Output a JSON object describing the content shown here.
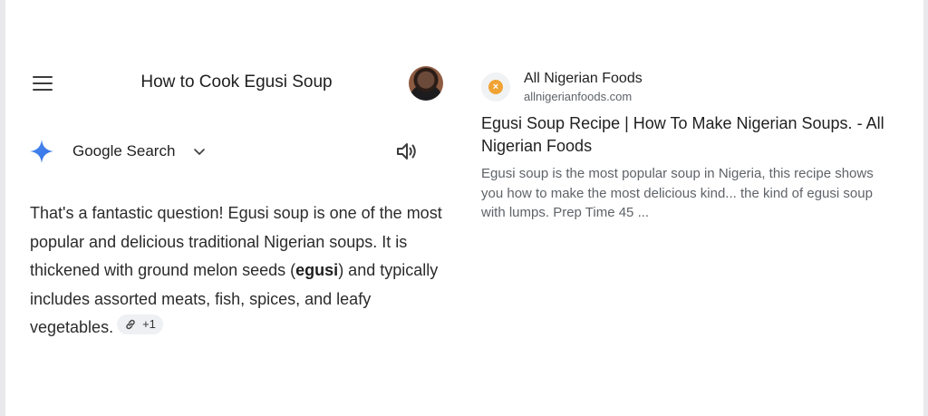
{
  "header": {
    "title": "How to Cook Egusi Soup",
    "menu_icon": "hamburger-icon",
    "avatar": "user-avatar"
  },
  "source_selector": {
    "icon": "gemini-sparkle-icon",
    "label": "Google Search",
    "chevron": "chevron-down-icon",
    "speaker_icon": "speaker-icon"
  },
  "answer": {
    "part1": "That's a fantastic question! Egusi soup is one of the most popular and delicious traditional Nigerian soups. It is thickened with ground melon seeds (",
    "bold": "egusi",
    "part2": ") and typically includes assorted meats, fish, spices, and leafy vegetables.",
    "chip_label": "+1",
    "chip_icon": "link-icon"
  },
  "result": {
    "site_name": "All Nigerian Foods",
    "site_url": "allnigerianfoods.com",
    "title": "Egusi Soup Recipe | How To Make Nigerian Soups. - All Nigerian Foods",
    "snippet": "Egusi soup is the most popular soup in Nigeria, this recipe shows you how to make the most delicious kind... the kind of egusi soup with lumps. Prep Time 45 ...",
    "logo_color": "#f0a334"
  }
}
